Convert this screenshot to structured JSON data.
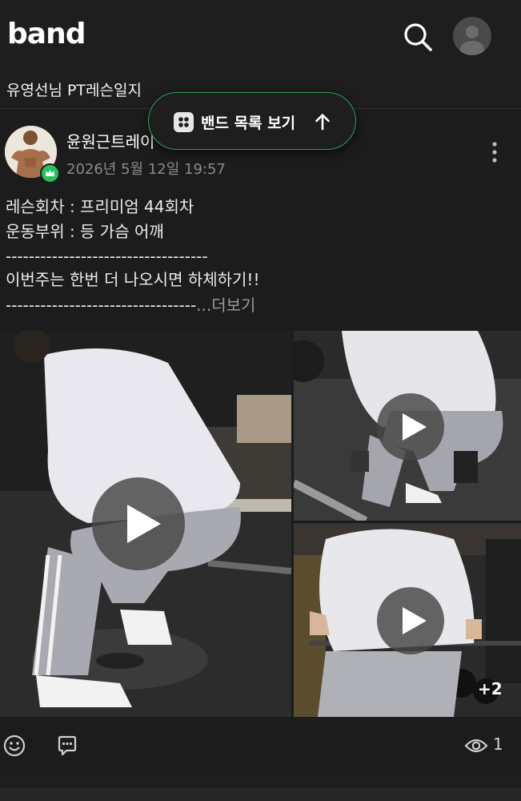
{
  "header": {
    "logo": "band",
    "search_icon": "search-icon",
    "avatar_icon": "user-avatar-icon"
  },
  "band": {
    "title": "유영선님 PT레슨일지"
  },
  "band_list_button": {
    "label": "밴드 목록 보기",
    "icon": "grid-icon",
    "arrow_icon": "arrow-up-icon",
    "border_color": "#2f9e57"
  },
  "post": {
    "author": "윤원근트레이",
    "date": "2026년 5월 12일 19:57",
    "badge_icon": "crown-icon",
    "badge_color": "#24c35c",
    "lines": [
      "레슨회차 : 프리미엄 44회차",
      "운동부위 : 등 가슴 어깨",
      "-----------------------------------",
      "이번주는 한번 더 나오시면 하체하기!!",
      "---------------------------------"
    ],
    "more_dots": "...",
    "more_label": "더보기",
    "media": [
      {
        "type": "video",
        "desc": "squat-on-plate"
      },
      {
        "type": "video",
        "desc": "barbell-pull"
      },
      {
        "type": "video",
        "desc": "seated-row",
        "extra_count": "+2"
      }
    ],
    "actions": {
      "emoji_icon": "emoji-icon",
      "comment_icon": "comment-icon",
      "view_icon": "eye-icon",
      "view_count": "1"
    }
  }
}
